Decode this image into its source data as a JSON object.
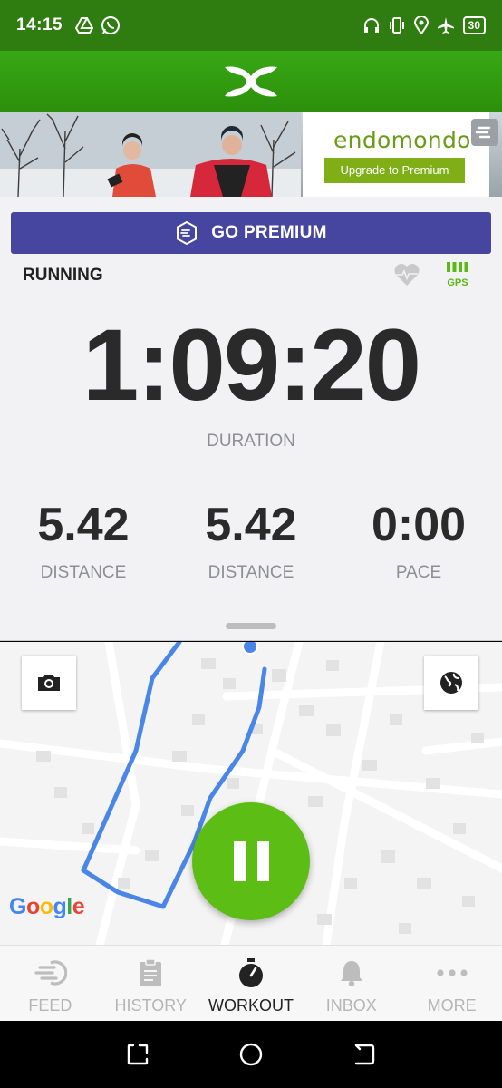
{
  "status_bar": {
    "time": "14:15",
    "battery": "30",
    "left_icons": [
      "drive-icon",
      "whatsapp-icon"
    ],
    "right_icons": [
      "headset-icon",
      "vibrate-icon",
      "location-icon",
      "airplane-icon",
      "battery-icon"
    ]
  },
  "header": {
    "logo": "under-armour-logo"
  },
  "ad": {
    "brand": "endomondo",
    "cta": "Upgrade to Premium"
  },
  "premium_button": {
    "label": "GO PREMIUM"
  },
  "workout": {
    "sport": "RUNNING",
    "gps_label": "GPS",
    "duration": "1:09:20",
    "duration_label": "DURATION",
    "stats": [
      {
        "value": "5.42",
        "label": "DISTANCE"
      },
      {
        "value": "5.42",
        "label": "DISTANCE"
      },
      {
        "value": "0:00",
        "label": "PACE"
      }
    ]
  },
  "map": {
    "google_letters": [
      "G",
      "o",
      "o",
      "g",
      "l",
      "e"
    ],
    "route_color": "#4a86e8"
  },
  "bottom_nav": {
    "items": [
      {
        "label": "FEED",
        "icon": "feed-icon",
        "active": false
      },
      {
        "label": "HISTORY",
        "icon": "history-icon",
        "active": false
      },
      {
        "label": "WORKOUT",
        "icon": "stopwatch-icon",
        "active": true
      },
      {
        "label": "INBOX",
        "icon": "bell-icon",
        "active": false
      },
      {
        "label": "MORE",
        "icon": "more-dots-icon",
        "active": false
      }
    ]
  },
  "colors": {
    "brand_green": "#37a814",
    "premium_purple": "#4646a0",
    "pause_green": "#5cbd14"
  }
}
